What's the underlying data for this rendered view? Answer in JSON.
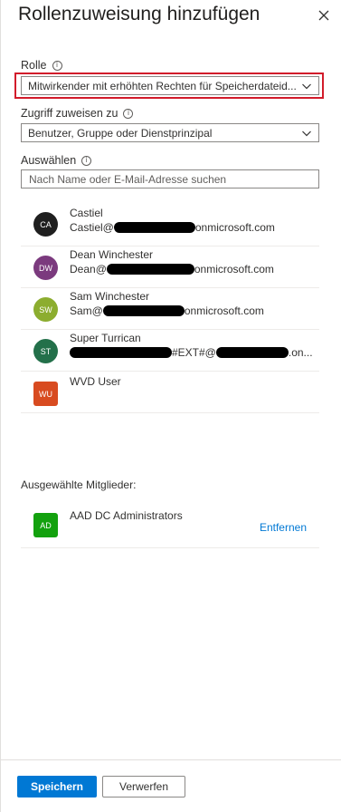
{
  "header": {
    "title": "Rollenzuweisung hinzufügen"
  },
  "role": {
    "label": "Rolle",
    "value": "Mitwirkender mit erhöhten Rechten für Speicherdateid..."
  },
  "assign_access": {
    "label": "Zugriff zuweisen zu",
    "value": "Benutzer, Gruppe oder Dienstprinzipal"
  },
  "select": {
    "label": "Auswählen",
    "placeholder": "Nach Name oder E-Mail-Adresse suchen"
  },
  "users": [
    {
      "initials": "CA",
      "name": "Castiel",
      "mail_prefix": "Castiel@",
      "mail_suffix": "onmicrosoft.com",
      "avatar_color": "#1f1f1f"
    },
    {
      "initials": "DW",
      "name": "Dean Winchester",
      "mail_prefix": "Dean@",
      "mail_suffix": "onmicrosoft.com",
      "avatar_color": "#7b3a7e"
    },
    {
      "initials": "SW",
      "name": "Sam Winchester",
      "mail_prefix": "Sam@",
      "mail_suffix": "onmicrosoft.com",
      "avatar_color": "#8cad2f"
    },
    {
      "initials": "ST",
      "name": "Super Turrican",
      "mail_middle": "#EXT#@",
      "mail_suffix": ".on...",
      "avatar_color": "#23704a"
    },
    {
      "initials": "WU",
      "name": "WVD User",
      "avatar_color": "#d84b20"
    }
  ],
  "selected": {
    "label": "Ausgewählte Mitglieder:",
    "members": [
      {
        "initials": "AD",
        "name": "AAD DC Administrators",
        "avatar_color": "#13a10e",
        "remove_label": "Entfernen"
      }
    ]
  },
  "footer": {
    "save_label": "Speichern",
    "discard_label": "Verwerfen"
  },
  "colors": {
    "accent": "#0078d4",
    "highlight_border": "#d21c2b"
  }
}
